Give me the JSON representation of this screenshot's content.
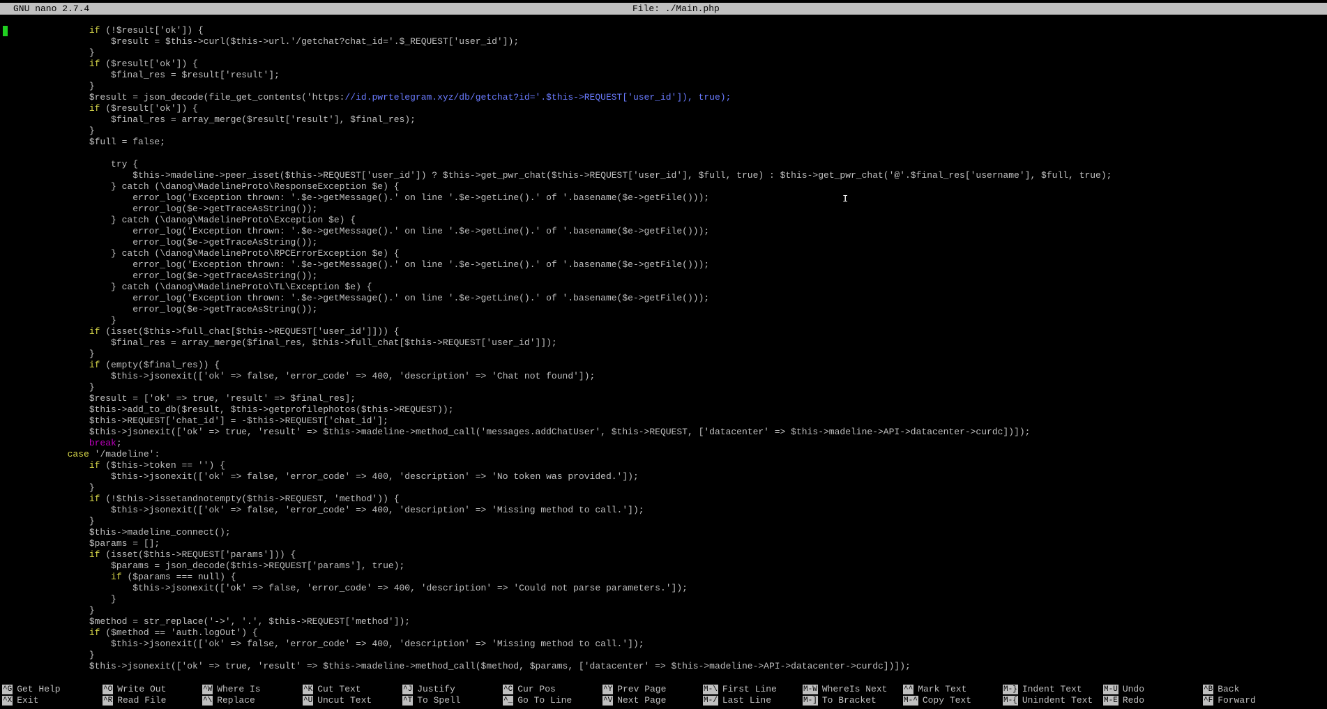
{
  "title": {
    "version": "GNU nano 2.7.4",
    "file": "File: ./Main.php"
  },
  "code_lines": [
    [
      {
        "t": "                if (!$result['ok']) {",
        "c": "kwif"
      }
    ],
    [
      {
        "t": "                    $result = $this->curl($this->url.'/getchat?chat_id='.$_REQUEST['user_id']);",
        "c": ""
      }
    ],
    [
      {
        "t": "                }",
        "c": ""
      }
    ],
    [
      {
        "t": "                if ($result['ok']) {",
        "c": "kwif"
      }
    ],
    [
      {
        "t": "                    $final_res = $result['result'];",
        "c": ""
      }
    ],
    [
      {
        "t": "                }",
        "c": ""
      }
    ],
    [
      {
        "t": "                $result = json_decode(file_get_contents('https:",
        "c": ""
      },
      {
        "t": "//id.pwrtelegram.xyz/db/getchat?id='.$this->REQUEST['user_id']), true);",
        "c": "str"
      }
    ],
    [
      {
        "t": "                if ($result['ok']) {",
        "c": "kwif"
      }
    ],
    [
      {
        "t": "                    $final_res = array_merge($result['result'], $final_res);",
        "c": ""
      }
    ],
    [
      {
        "t": "                }",
        "c": ""
      }
    ],
    [
      {
        "t": "                $full = false;",
        "c": ""
      }
    ],
    [
      {
        "t": "",
        "c": ""
      }
    ],
    [
      {
        "t": "                    try {",
        "c": ""
      }
    ],
    [
      {
        "t": "                        $this->madeline->peer_isset($this->REQUEST['user_id']) ? $this->get_pwr_chat($this->REQUEST['user_id'], $full, true) : $this->get_pwr_chat('@'.$final_res['username'], $full, true);",
        "c": ""
      }
    ],
    [
      {
        "t": "                    } catch (\\danog\\MadelineProto\\ResponseException $e) {",
        "c": ""
      }
    ],
    [
      {
        "t": "                        error_log('Exception thrown: '.$e->getMessage().' on line '.$e->getLine().' of '.basename($e->getFile()));",
        "c": ""
      }
    ],
    [
      {
        "t": "                        error_log($e->getTraceAsString());",
        "c": ""
      }
    ],
    [
      {
        "t": "                    } catch (\\danog\\MadelineProto\\Exception $e) {",
        "c": ""
      }
    ],
    [
      {
        "t": "                        error_log('Exception thrown: '.$e->getMessage().' on line '.$e->getLine().' of '.basename($e->getFile()));",
        "c": ""
      }
    ],
    [
      {
        "t": "                        error_log($e->getTraceAsString());",
        "c": ""
      }
    ],
    [
      {
        "t": "                    } catch (\\danog\\MadelineProto\\RPCErrorException $e) {",
        "c": ""
      }
    ],
    [
      {
        "t": "                        error_log('Exception thrown: '.$e->getMessage().' on line '.$e->getLine().' of '.basename($e->getFile()));",
        "c": ""
      }
    ],
    [
      {
        "t": "                        error_log($e->getTraceAsString());",
        "c": ""
      }
    ],
    [
      {
        "t": "                    } catch (\\danog\\MadelineProto\\TL\\Exception $e) {",
        "c": ""
      }
    ],
    [
      {
        "t": "                        error_log('Exception thrown: '.$e->getMessage().' on line '.$e->getLine().' of '.basename($e->getFile()));",
        "c": ""
      }
    ],
    [
      {
        "t": "                        error_log($e->getTraceAsString());",
        "c": ""
      }
    ],
    [
      {
        "t": "                    }",
        "c": ""
      }
    ],
    [
      {
        "t": "                if (isset($this->full_chat[$this->REQUEST['user_id']])) {",
        "c": "kwif"
      }
    ],
    [
      {
        "t": "                    $final_res = array_merge($final_res, $this->full_chat[$this->REQUEST['user_id']]);",
        "c": ""
      }
    ],
    [
      {
        "t": "                }",
        "c": ""
      }
    ],
    [
      {
        "t": "                if (empty($final_res)) {",
        "c": "kwif"
      }
    ],
    [
      {
        "t": "                    $this->jsonexit(['ok' => false, 'error_code' => 400, 'description' => 'Chat not found']);",
        "c": ""
      }
    ],
    [
      {
        "t": "                }",
        "c": ""
      }
    ],
    [
      {
        "t": "                $result = ['ok' => true, 'result' => $final_res];",
        "c": ""
      }
    ],
    [
      {
        "t": "                $this->add_to_db($result, $this->getprofilephotos($this->REQUEST));",
        "c": ""
      }
    ],
    [
      {
        "t": "                $this->REQUEST['chat_id'] = -$this->REQUEST['chat_id'];",
        "c": ""
      }
    ],
    [
      {
        "t": "                $this->jsonexit(['ok' => true, 'result' => $this->madeline->method_call('messages.addChatUser', $this->REQUEST, ['datacenter' => $this->madeline->API->datacenter->curdc])]);",
        "c": ""
      }
    ],
    [
      {
        "t": "                ",
        "c": ""
      },
      {
        "t": "break",
        "c": "br"
      },
      {
        "t": ";",
        "c": ""
      }
    ],
    [
      {
        "t": "            ",
        "c": ""
      },
      {
        "t": "case",
        "c": "kw"
      },
      {
        "t": " '/madeline':",
        "c": ""
      }
    ],
    [
      {
        "t": "                if ($this->token == '') {",
        "c": "kwif"
      }
    ],
    [
      {
        "t": "                    $this->jsonexit(['ok' => false, 'error_code' => 400, 'description' => 'No token was provided.']);",
        "c": ""
      }
    ],
    [
      {
        "t": "                }",
        "c": ""
      }
    ],
    [
      {
        "t": "                if (!$this->issetandnotempty($this->REQUEST, 'method')) {",
        "c": "kwif"
      }
    ],
    [
      {
        "t": "                    $this->jsonexit(['ok' => false, 'error_code' => 400, 'description' => 'Missing method to call.']);",
        "c": ""
      }
    ],
    [
      {
        "t": "                }",
        "c": ""
      }
    ],
    [
      {
        "t": "                $this->madeline_connect();",
        "c": ""
      }
    ],
    [
      {
        "t": "                $params = [];",
        "c": ""
      }
    ],
    [
      {
        "t": "                if (isset($this->REQUEST['params'])) {",
        "c": "kwif"
      }
    ],
    [
      {
        "t": "                    $params = json_decode($this->REQUEST['params'], true);",
        "c": ""
      }
    ],
    [
      {
        "t": "                    if ($params === null) {",
        "c": "kwif"
      }
    ],
    [
      {
        "t": "                        $this->jsonexit(['ok' => false, 'error_code' => 400, 'description' => 'Could not parse parameters.']);",
        "c": ""
      }
    ],
    [
      {
        "t": "                    }",
        "c": ""
      }
    ],
    [
      {
        "t": "                }",
        "c": ""
      }
    ],
    [
      {
        "t": "                $method = str_replace('->', '.', $this->REQUEST['method']);",
        "c": ""
      }
    ],
    [
      {
        "t": "                if ($method == 'auth.logOut') {",
        "c": "kwif"
      }
    ],
    [
      {
        "t": "                    $this->jsonexit(['ok' => false, 'error_code' => 400, 'description' => 'Missing method to call.']);",
        "c": ""
      }
    ],
    [
      {
        "t": "                }",
        "c": ""
      }
    ],
    [
      {
        "t": "                $this->jsonexit(['ok' => true, 'result' => $this->madeline->method_call($method, $params, ['datacenter' => $this->madeline->API->datacenter->curdc])]);",
        "c": ""
      }
    ]
  ],
  "shortcuts_row1": [
    {
      "key": "^G",
      "label": "Get Help"
    },
    {
      "key": "^O",
      "label": "Write Out"
    },
    {
      "key": "^W",
      "label": "Where Is"
    },
    {
      "key": "^K",
      "label": "Cut Text"
    },
    {
      "key": "^J",
      "label": "Justify"
    },
    {
      "key": "^C",
      "label": "Cur Pos"
    },
    {
      "key": "^Y",
      "label": "Prev Page"
    },
    {
      "key": "M-\\",
      "label": "First Line"
    },
    {
      "key": "M-W",
      "label": "WhereIs Next"
    },
    {
      "key": "^^",
      "label": "Mark Text"
    },
    {
      "key": "M-}",
      "label": "Indent Text"
    },
    {
      "key": "M-U",
      "label": "Undo"
    },
    {
      "key": "^B",
      "label": "Back"
    }
  ],
  "shortcuts_row2": [
    {
      "key": "^X",
      "label": "Exit"
    },
    {
      "key": "^R",
      "label": "Read File"
    },
    {
      "key": "^\\",
      "label": "Replace"
    },
    {
      "key": "^U",
      "label": "Uncut Text"
    },
    {
      "key": "^T",
      "label": "To Spell"
    },
    {
      "key": "^_",
      "label": "Go To Line"
    },
    {
      "key": "^V",
      "label": "Next Page"
    },
    {
      "key": "M-/",
      "label": "Last Line"
    },
    {
      "key": "M-]",
      "label": "To Bracket"
    },
    {
      "key": "M-^",
      "label": "Copy Text"
    },
    {
      "key": "M-{",
      "label": "Unindent Text"
    },
    {
      "key": "M-E",
      "label": "Redo"
    },
    {
      "key": "^F",
      "label": "Forward"
    }
  ],
  "colors": {
    "background": "#000000",
    "text": "#c0c0c0",
    "titlebar": "#c0c0c0",
    "keyword": "#d8d84a",
    "break_keyword": "#c000c0",
    "string_url": "#6a7bff",
    "cursor": "#20d020"
  },
  "icons": {
    "text_cursor": "ibeam-cursor-icon"
  }
}
